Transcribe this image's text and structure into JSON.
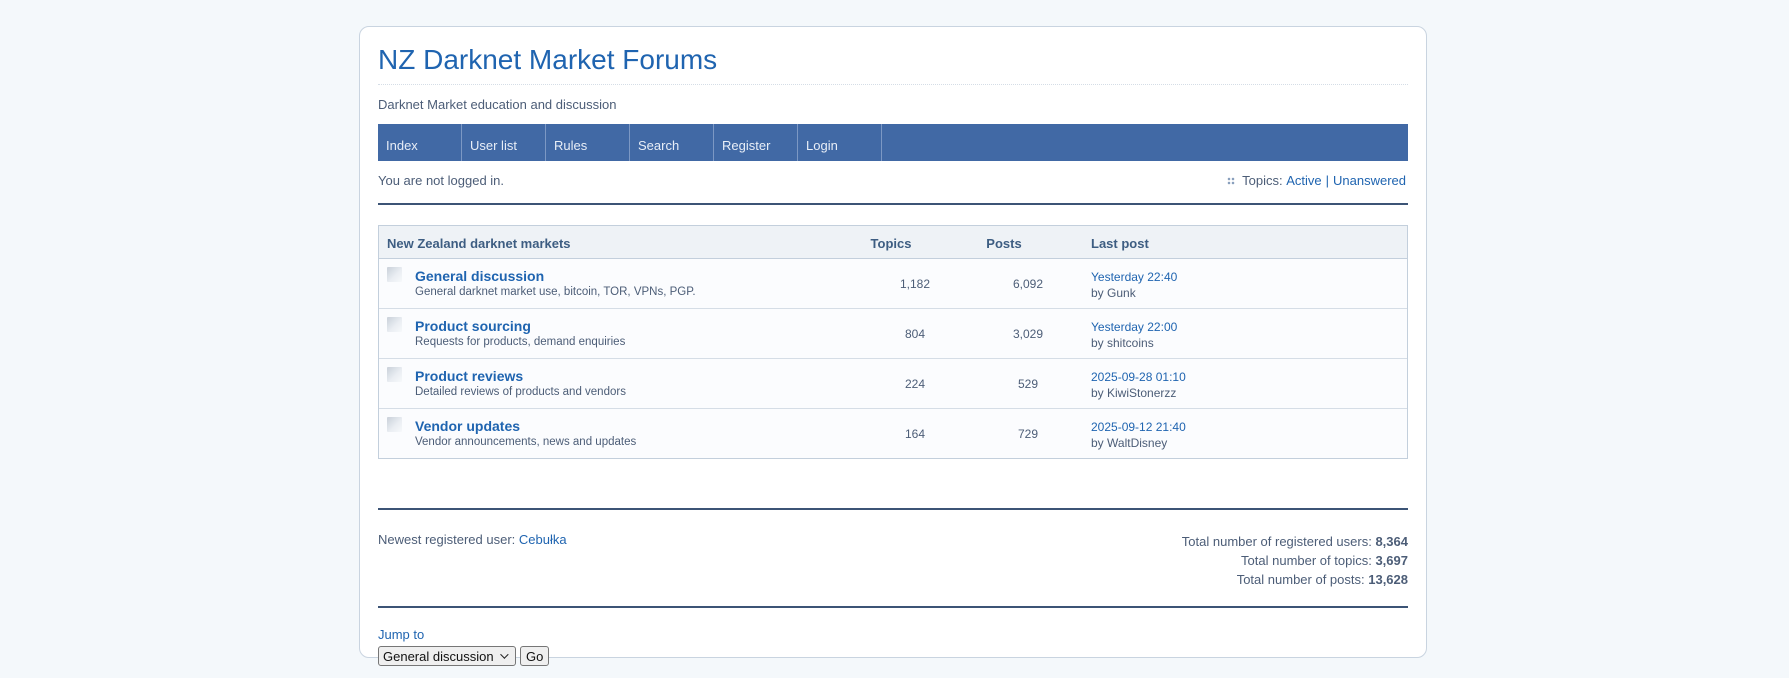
{
  "header": {
    "title": "NZ Darknet Market Forums",
    "description": "Darknet Market education and discussion"
  },
  "nav": {
    "items": [
      "Index",
      "User list",
      "Rules",
      "Search",
      "Register",
      "Login"
    ]
  },
  "status": {
    "login_text": "You are not logged in.",
    "topics_label": "Topics:",
    "active": "Active",
    "separator": "|",
    "unanswered": "Unanswered"
  },
  "forum_table": {
    "headers": {
      "forum": "New Zealand darknet markets",
      "topics": "Topics",
      "posts": "Posts",
      "last_post": "Last post"
    },
    "rows": [
      {
        "name": "General discussion",
        "desc": "General darknet market use, bitcoin, TOR, VPNs, PGP.",
        "topics": "1,182",
        "posts": "6,092",
        "last_date": "Yesterday 22:40",
        "last_by": "by Gunk"
      },
      {
        "name": "Product sourcing",
        "desc": "Requests for products, demand enquiries",
        "topics": "804",
        "posts": "3,029",
        "last_date": "Yesterday 22:00",
        "last_by": "by shitcoins"
      },
      {
        "name": "Product reviews",
        "desc": "Detailed reviews of products and vendors",
        "topics": "224",
        "posts": "529",
        "last_date": "2025-09-28 01:10",
        "last_by": "by KiwiStonerzz"
      },
      {
        "name": "Vendor updates",
        "desc": "Vendor announcements, news and updates",
        "topics": "164",
        "posts": "729",
        "last_date": "2025-09-12 21:40",
        "last_by": "by WaltDisney"
      }
    ]
  },
  "stats": {
    "newest_label": "Newest registered user:",
    "newest_user": "Cebułka",
    "users_label": "Total number of registered users:",
    "users_value": "8,364",
    "topics_label": "Total number of topics:",
    "topics_value": "3,697",
    "posts_label": "Total number of posts:",
    "posts_value": "13,628"
  },
  "jump": {
    "label": "Jump to",
    "selected": "General discussion",
    "go_label": "Go"
  }
}
